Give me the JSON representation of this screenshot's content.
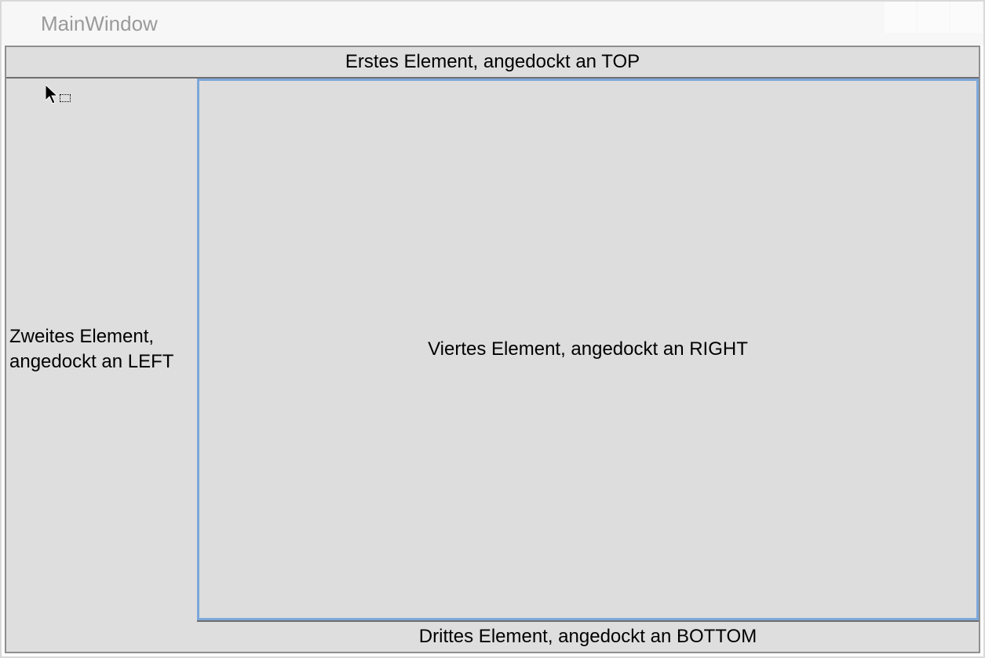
{
  "window": {
    "title": "MainWindow"
  },
  "panels": {
    "top": "Erstes Element, angedockt an TOP",
    "left": "Zweites Element, angedockt an LEFT",
    "right": "Viertes Element, angedockt an RIGHT",
    "bottom": "Drittes Element, angedockt an BOTTOM"
  }
}
